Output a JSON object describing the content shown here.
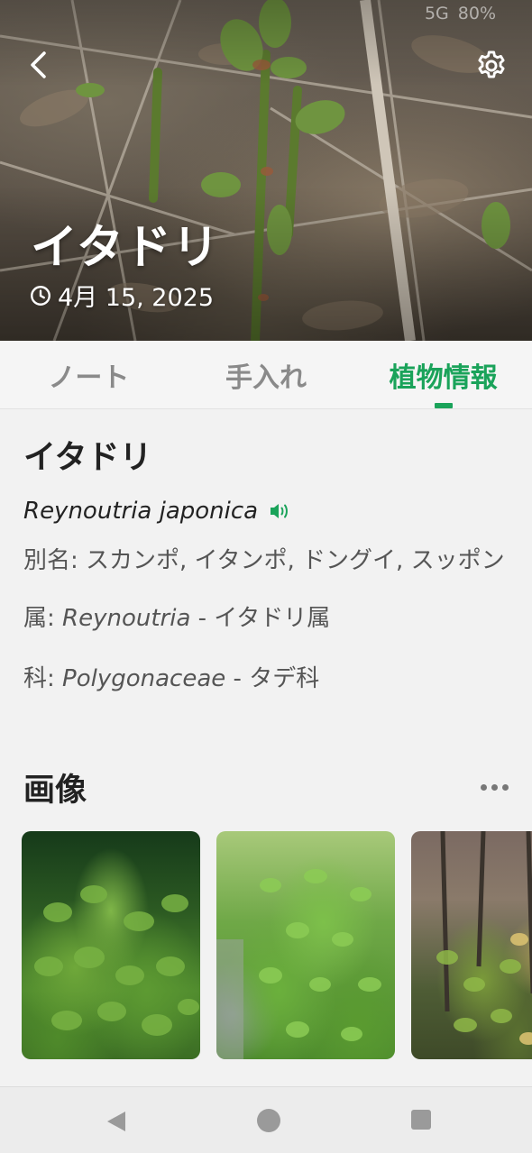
{
  "status_bar": {
    "network": "5G",
    "battery": "80%"
  },
  "header": {
    "title": "イタドリ",
    "date": "4月 15, 2025",
    "back_icon": "chevron-left-icon",
    "settings_icon": "gear-icon",
    "date_icon": "clock-icon"
  },
  "tabs": [
    {
      "label": "ノート",
      "active": false
    },
    {
      "label": "手入れ",
      "active": false
    },
    {
      "label": "植物情報",
      "active": true
    }
  ],
  "plant_info": {
    "common_name": "イタドリ",
    "scientific_name": "Reynoutria japonica",
    "audio_icon": "speaker-icon",
    "aliases_label": "別名:",
    "aliases": "スカンポ, イタンポ, ドングイ, スッポン",
    "genus_label": "属:",
    "genus_latin": "Reynoutria",
    "genus_local": "- イタドリ属",
    "family_label": "科:",
    "family_latin": "Polygonaceae",
    "family_local": "- タデ科"
  },
  "images": {
    "title": "画像",
    "more_icon": "more-horizontal-icon",
    "count": 3
  },
  "navbar": {
    "back_icon": "triangle-back-icon",
    "home_icon": "circle-home-icon",
    "recent_icon": "square-recent-icon"
  },
  "colors": {
    "accent": "#1aa35a",
    "background": "#f2f2f2"
  }
}
